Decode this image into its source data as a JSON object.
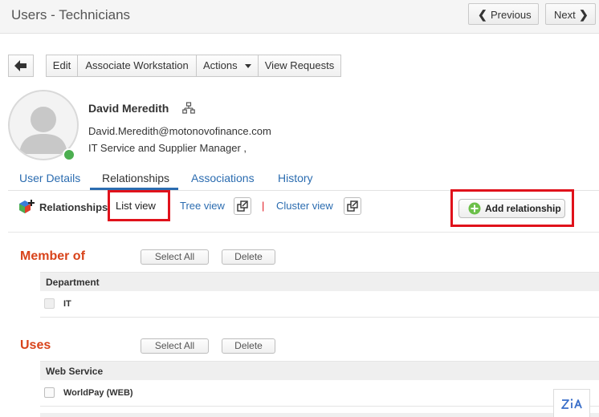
{
  "header": {
    "title": "Users - Technicians",
    "previous_label": "Previous",
    "next_label": "Next"
  },
  "toolbar": {
    "back_icon": "arrow-left-icon",
    "edit_label": "Edit",
    "associate_label": "Associate Workstation",
    "actions_label": "Actions",
    "view_requests_label": "View Requests"
  },
  "user": {
    "name": "David Meredith",
    "email": "David.Meredith@motonovofinance.com",
    "role": "IT Service and Supplier Manager ,",
    "status_color": "#4caf50"
  },
  "tabs": [
    {
      "label": "User Details"
    },
    {
      "label": "Relationships",
      "active": true
    },
    {
      "label": "Associations"
    },
    {
      "label": "History"
    }
  ],
  "relationships_bar": {
    "label": "Relationships",
    "list_view": "List view",
    "tree_view": "Tree view",
    "separator": "|",
    "cluster_view": "Cluster view",
    "add_label": "Add relationship"
  },
  "groups": [
    {
      "title": "Member of",
      "select_all": "Select All",
      "delete": "Delete",
      "column": "Department",
      "rows": [
        "IT"
      ]
    },
    {
      "title": "Uses",
      "select_all": "Select All",
      "delete": "Delete",
      "column": "Web Service",
      "rows": [
        "WorldPay (WEB)"
      ]
    }
  ],
  "colors": {
    "accent": "#2b6cb0",
    "group_title": "#d8431a",
    "highlight": "#e0121b"
  }
}
